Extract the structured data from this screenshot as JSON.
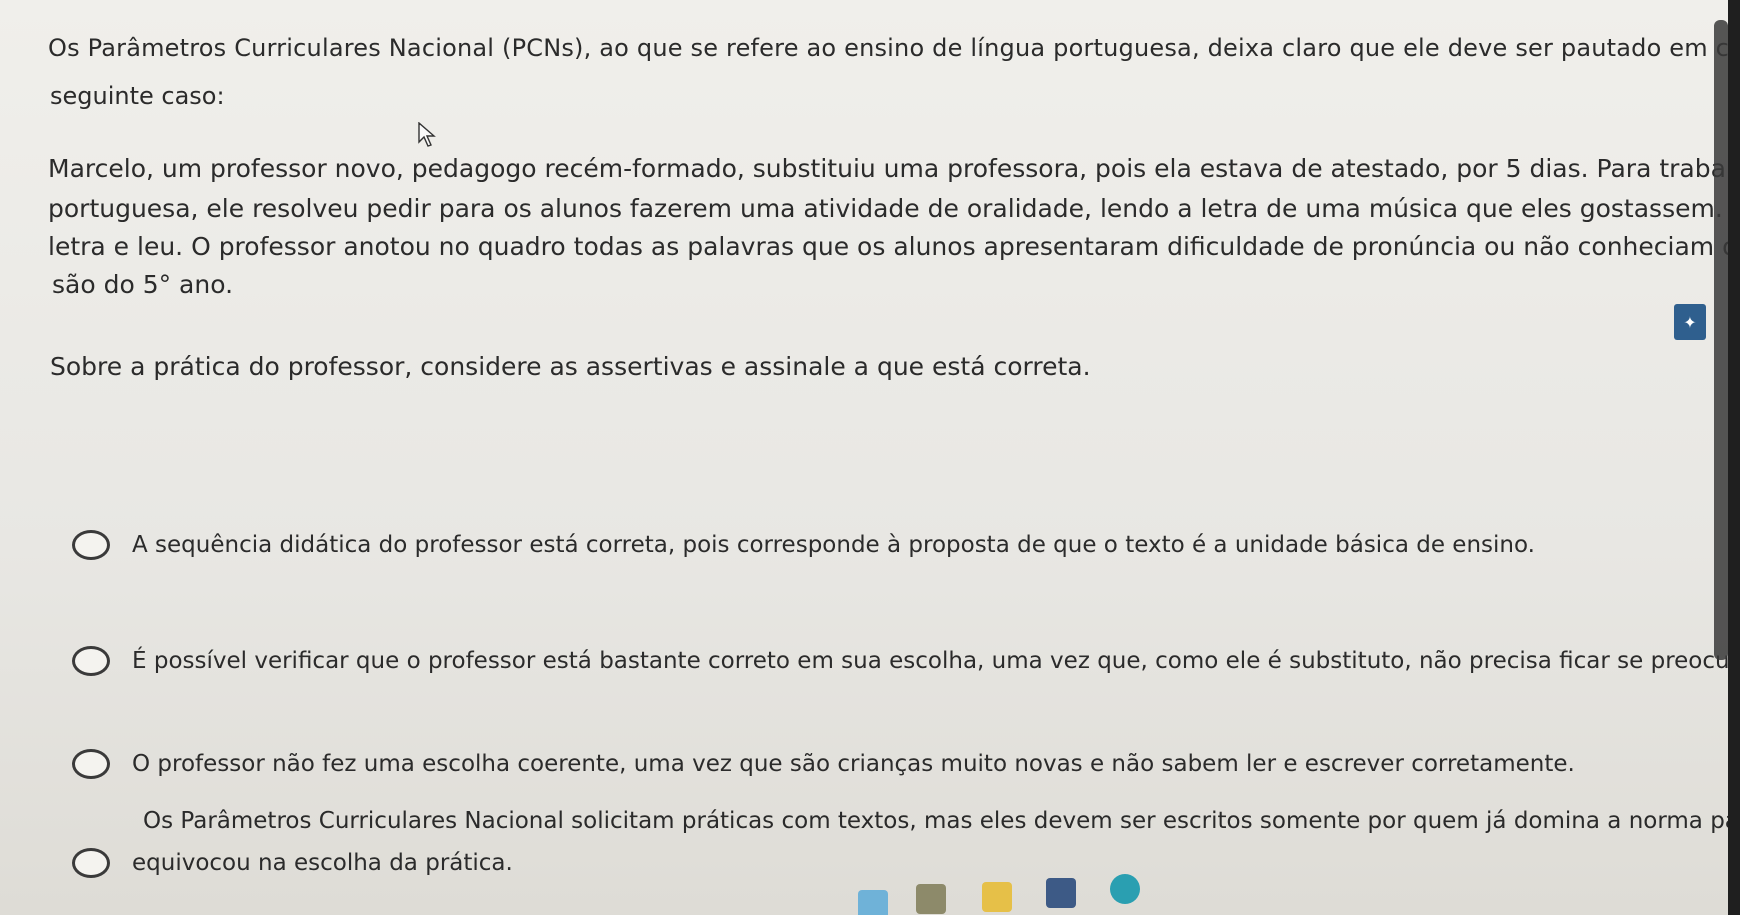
{
  "intro": {
    "line1": "Os Parâmetros Curriculares Nacional (PCNs), ao que se refere ao ensino de língua portuguesa, deixa claro que ele deve ser pautado em contextos. Analise o",
    "line2": "seguinte caso:"
  },
  "case": {
    "line1": "Marcelo, um professor novo, pedagogo recém-formado, substituiu uma professora, pois ela estava de atestado, por 5 dias. Para trabalhar o conteúdo de língua",
    "line2": "portuguesa, ele resolveu pedir para os alunos fazerem uma atividade de oralidade, lendo a letra de uma música que eles gostassem. Cada aluno escreveu a",
    "line3": "letra e leu. O professor anotou no quadro todas as palavras que os alunos apresentaram dificuldade de pronúncia ou não conheciam o significado. Os alunos",
    "line4": "são do 5° ano."
  },
  "question": "Sobre a prática do professor, considere as assertivas e assinale a que está correta.",
  "options": [
    {
      "text": "A sequência didática do professor está correta, pois corresponde à proposta de que o texto é a unidade básica de ensino."
    },
    {
      "text": "É possível verificar que o professor está bastante correto em sua escolha, uma vez que, como ele é substituto, não precisa ficar se preocupando muito com o trabalho"
    },
    {
      "text": "O professor não fez uma escolha coerente, uma vez que são crianças muito novas e não sabem ler e escrever corretamente."
    },
    {
      "text_line1": "Os Parâmetros Curriculares Nacional solicitam práticas com textos, mas eles devem ser escritos somente por quem já domina a norma padrão culta, por isso o professor se",
      "text_line2": "equivocou na escolha da prática."
    }
  ],
  "colors": {
    "background": "#e9e8e4",
    "text": "#2b2b2b",
    "widget_blue": "#2f5f8e"
  },
  "icons": [
    "cursor-arrow-icon",
    "taskbar-app-icon",
    "edge-browser-icon",
    "word-icon",
    "folder-icon"
  ]
}
